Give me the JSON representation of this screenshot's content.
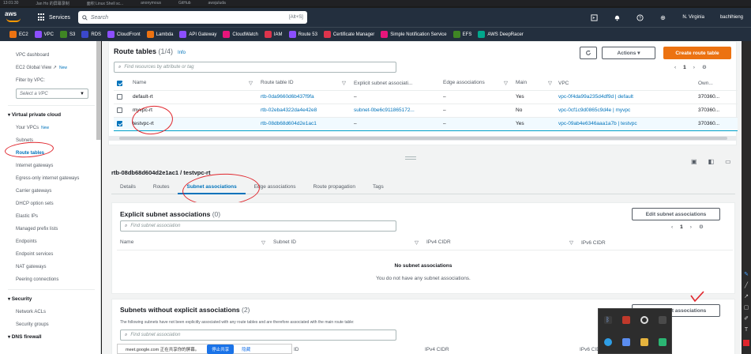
{
  "browser": {
    "tabs": [
      "13:01:30",
      "Jan Ho 的屏幕录制",
      "面积 Linux Shell sc...",
      "anonymous",
      "GitHub",
      "awsjuluda"
    ]
  },
  "topnav": {
    "logo": "aws",
    "services": "Services",
    "search_placeholder": "Search",
    "search_shortcut": "[Alt+S]",
    "region": "N. Virginia",
    "user": "bachlhieng"
  },
  "favorites": [
    {
      "label": "EC2",
      "color": "#ec7211"
    },
    {
      "label": "VPC",
      "color": "#8c4fff"
    },
    {
      "label": "S3",
      "color": "#3f8624"
    },
    {
      "label": "RDS",
      "color": "#3b48cc"
    },
    {
      "label": "CloudFront",
      "color": "#8c4fff"
    },
    {
      "label": "Lambda",
      "color": "#ec7211"
    },
    {
      "label": "API Gateway",
      "color": "#8c4fff"
    },
    {
      "label": "CloudWatch",
      "color": "#e7157b"
    },
    {
      "label": "IAM",
      "color": "#dd344c"
    },
    {
      "label": "Route 53",
      "color": "#8c4fff"
    },
    {
      "label": "Certificate Manager",
      "color": "#dd344c"
    },
    {
      "label": "Simple Notification Service",
      "color": "#e7157b"
    },
    {
      "label": "EFS",
      "color": "#3f8624"
    },
    {
      "label": "AWS DeepRacer",
      "color": "#01a88d"
    }
  ],
  "sidebar": {
    "dashboard": "VPC dashboard",
    "global_view": "EC2 Global View",
    "new_badge": "New",
    "filter_label": "Filter by VPC:",
    "filter_placeholder": "Select a VPC",
    "section_vpc": "Virtual private cloud",
    "items": [
      "Your VPCs",
      "Subnets",
      "Route tables",
      "Internet gateways",
      "Egress-only internet gateways",
      "Carrier gateways",
      "DHCP option sets",
      "Elastic IPs",
      "Managed prefix lists",
      "Endpoints",
      "Endpoint services",
      "NAT gateways",
      "Peering connections"
    ],
    "section_security": "Security",
    "security_items": [
      "Network ACLs",
      "Security groups"
    ],
    "section_dns": "DNS firewall"
  },
  "route_tables": {
    "title": "Route tables",
    "count": "(1/4)",
    "info": "Info",
    "filter_placeholder": "Find resources by attribute or tag",
    "actions": "Actions",
    "create": "Create route table",
    "page": "1",
    "columns": [
      "Name",
      "Route table ID",
      "Explicit subnet associati...",
      "Edge associations",
      "Main",
      "VPC",
      "Own..."
    ],
    "rows": [
      {
        "name": "default-rt",
        "id": "rtb-0da9660d6b437f9fa",
        "explicit": "–",
        "edge": "–",
        "main": "Yes",
        "vpc": "vpc-0f4da99a235d4df9d | default",
        "owner": "370360...",
        "selected": false
      },
      {
        "name": "myvpc-rt",
        "id": "rtb-02eba4322da4e42e8",
        "explicit": "subnet-0be6c911865172...",
        "edge": "–",
        "main": "No",
        "vpc": "vpc-0cf1c9d0865c9d4e | myvpc",
        "owner": "370360...",
        "selected": false
      },
      {
        "name": "testvpc-rt",
        "id": "rtb-08db68d604d2e1ac1",
        "explicit": "–",
        "edge": "–",
        "main": "Yes",
        "vpc": "vpc-09ab4e6346aaa1a7b | testvpc",
        "owner": "370360...",
        "selected": true
      }
    ]
  },
  "detail": {
    "title": "rtb-08db68d604d2e1ac1 / testvpc-rt",
    "tabs": [
      "Details",
      "Routes",
      "Subnet associations",
      "Edge associations",
      "Route propagation",
      "Tags"
    ],
    "explicit": {
      "title": "Explicit subnet associations",
      "count": "(0)",
      "edit": "Edit subnet associations",
      "filter_placeholder": "Find subnet association",
      "page": "1",
      "columns": [
        "Name",
        "Subnet ID",
        "IPv4 CIDR",
        "IPv6 CIDR"
      ],
      "empty_title": "No subnet associations",
      "empty_desc": "You do not have any subnet associations."
    },
    "without": {
      "title": "Subnets without explicit associations",
      "count": "(2)",
      "edit": "Edit subnet associations",
      "desc": "The following subnets have not been explicitly associated with any route tables and are therefore associated with the main route table:",
      "filter_placeholder": "Find subnet association",
      "columns": [
        "ID",
        "IPv4 CIDR",
        "IPv6 CIDR"
      ]
    }
  },
  "share_bar": {
    "text": "meet.google.com 正在共享你的屏幕。",
    "stop": "停止共享",
    "hide": "隐藏"
  }
}
